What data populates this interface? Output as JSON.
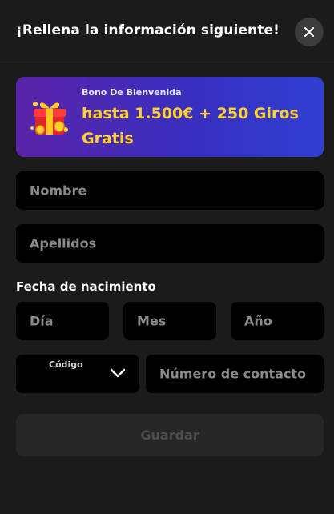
{
  "modal": {
    "title": "¡Rellena la información siguiente!",
    "close_icon": "close-icon"
  },
  "banner": {
    "subtitle": "Bono De Bienvenida",
    "headline": "hasta 1.500€ + 250 Giros Gratis",
    "icon": "gift-icon",
    "colors": {
      "accent": "#ffd12e",
      "gradient_start": "#5a24a8",
      "gradient_end": "#2f3fd2"
    }
  },
  "form": {
    "first_name": {
      "placeholder": "Nombre",
      "value": ""
    },
    "last_name": {
      "placeholder": "Apellidos",
      "value": ""
    },
    "dob": {
      "label": "Fecha de nacimiento",
      "day": {
        "placeholder": "Día",
        "value": ""
      },
      "month": {
        "placeholder": "Mes",
        "value": ""
      },
      "year": {
        "placeholder": "Año",
        "value": ""
      }
    },
    "phone": {
      "code_label": "Código",
      "code_value": "",
      "number": {
        "placeholder": "Número de contacto",
        "value": ""
      }
    },
    "save_label": "Guardar"
  }
}
